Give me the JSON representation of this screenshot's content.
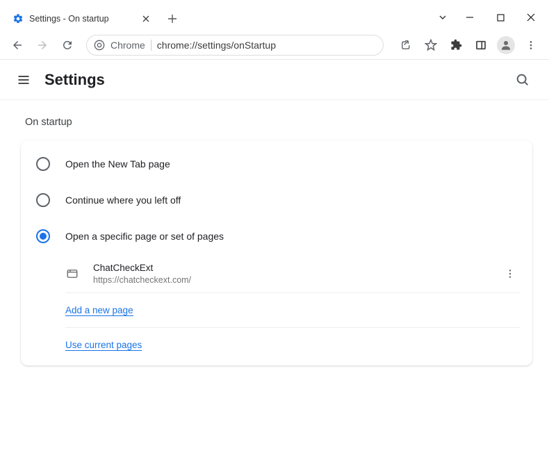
{
  "browser": {
    "tab_title": "Settings - On startup",
    "address_prefix": "Chrome",
    "address_url": "chrome://settings/onStartup"
  },
  "header": {
    "title": "Settings"
  },
  "section": {
    "title": "On startup"
  },
  "options": {
    "opt1": "Open the New Tab page",
    "opt2": "Continue where you left off",
    "opt3": "Open a specific page or set of pages"
  },
  "pages": [
    {
      "name": "ChatCheckExt",
      "url": "https://chatcheckext.com/"
    }
  ],
  "actions": {
    "add_page": "Add a new page",
    "use_current": "Use current pages"
  }
}
